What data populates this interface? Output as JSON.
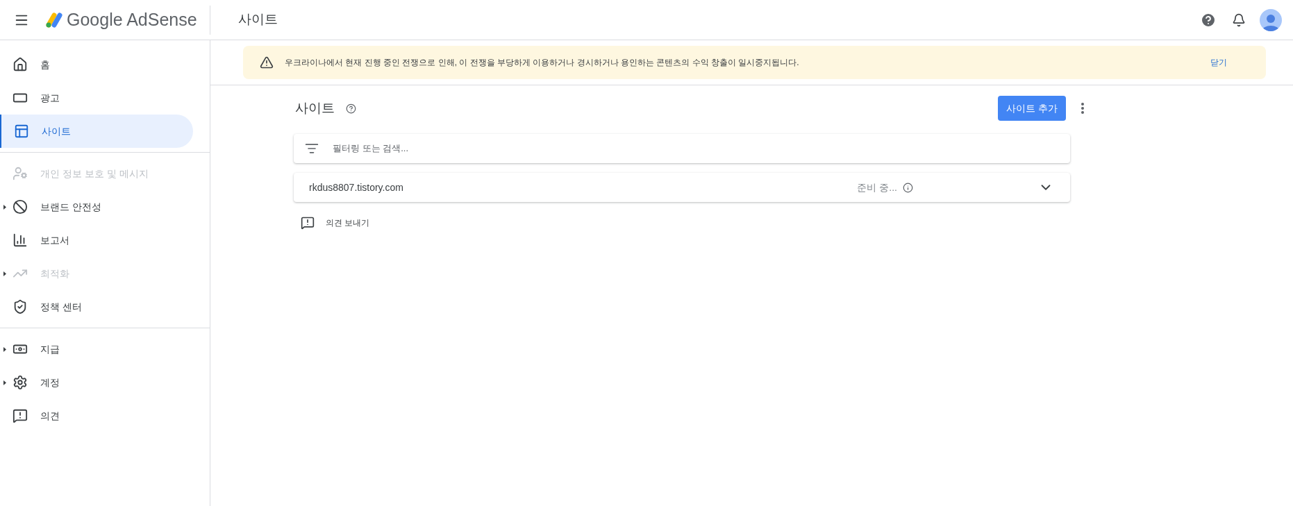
{
  "header": {
    "brand": "Google AdSense",
    "page_title": "사이트"
  },
  "sidebar": {
    "groups": [
      [
        {
          "label": "홈",
          "selected": false,
          "disabled": false,
          "expandable": false
        },
        {
          "label": "광고",
          "selected": false,
          "disabled": false,
          "expandable": false
        },
        {
          "label": "사이트",
          "selected": true,
          "disabled": false,
          "expandable": false
        }
      ],
      [
        {
          "label": "개인 정보 보호 및 메시지",
          "selected": false,
          "disabled": true,
          "expandable": false
        },
        {
          "label": "브랜드 안전성",
          "selected": false,
          "disabled": false,
          "expandable": true
        },
        {
          "label": "보고서",
          "selected": false,
          "disabled": false,
          "expandable": false
        },
        {
          "label": "최적화",
          "selected": false,
          "disabled": true,
          "expandable": true
        },
        {
          "label": "정책 센터",
          "selected": false,
          "disabled": false,
          "expandable": false
        }
      ],
      [
        {
          "label": "지급",
          "selected": false,
          "disabled": false,
          "expandable": true
        },
        {
          "label": "계정",
          "selected": false,
          "disabled": false,
          "expandable": true
        },
        {
          "label": "의견",
          "selected": false,
          "disabled": false,
          "expandable": false
        }
      ]
    ]
  },
  "banner": {
    "message": "우크라이나에서 현재 진행 중인 전쟁으로 인해, 이 전쟁을 부당하게 이용하거나 경시하거나 용인하는 콘텐츠의 수익 창출이 일시중지됩니다.",
    "dismiss": "닫기"
  },
  "content": {
    "title": "사이트",
    "add_button": "사이트 추가",
    "filter": {
      "placeholder": "필터링 또는 검색..."
    },
    "sites": [
      {
        "domain": "rkdus8807.tistory.com",
        "status": "준비 중...",
        "expanded": false
      }
    ],
    "feedback": "의견 보내기"
  }
}
